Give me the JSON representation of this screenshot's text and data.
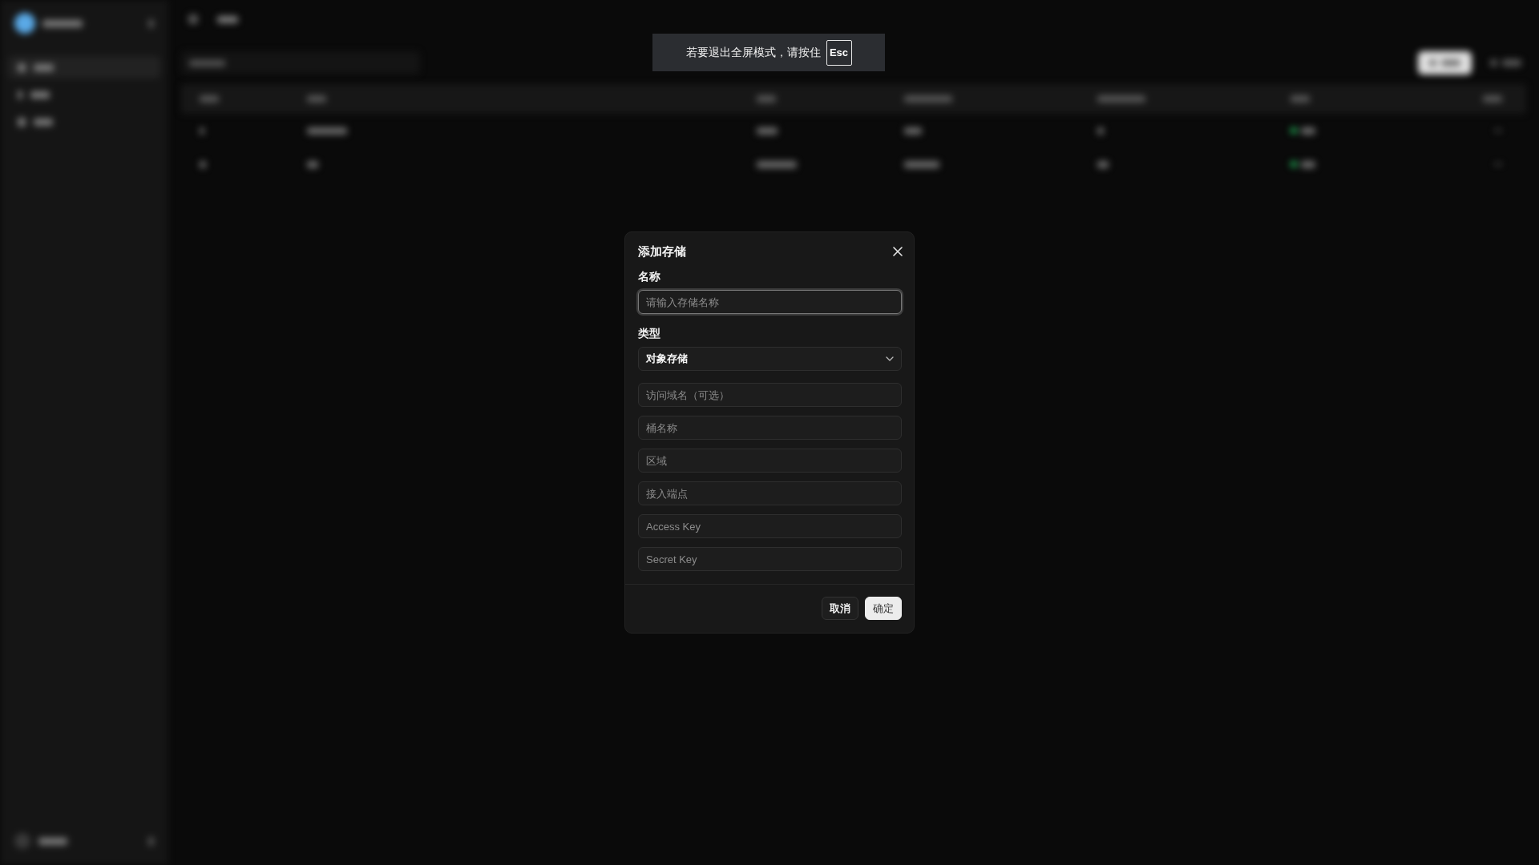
{
  "fullscreen_notice": {
    "text": "若要退出全屏模式，请按住",
    "key": "Esc"
  },
  "backdrop": {
    "blurred": true
  },
  "dialog": {
    "title": "添加存储",
    "fields": [
      {
        "kind": "text",
        "label": "名称",
        "placeholder": "请输入存储名称",
        "focused": true
      },
      {
        "kind": "select",
        "label": "类型",
        "value": "对象存储"
      },
      {
        "kind": "text",
        "placeholder": "访问域名（可选）",
        "focused": false
      },
      {
        "kind": "text",
        "placeholder": "桶名称",
        "focused": false
      },
      {
        "kind": "text",
        "placeholder": "区域",
        "focused": false
      },
      {
        "kind": "text",
        "placeholder": "接入端点",
        "focused": false
      },
      {
        "kind": "text",
        "placeholder": "Access Key",
        "focused": false
      },
      {
        "kind": "text",
        "placeholder": "Secret Key",
        "focused": false
      }
    ],
    "buttons": [
      {
        "kind": "secondary",
        "label": "取消"
      },
      {
        "kind": "primary",
        "label": "确定"
      }
    ]
  }
}
